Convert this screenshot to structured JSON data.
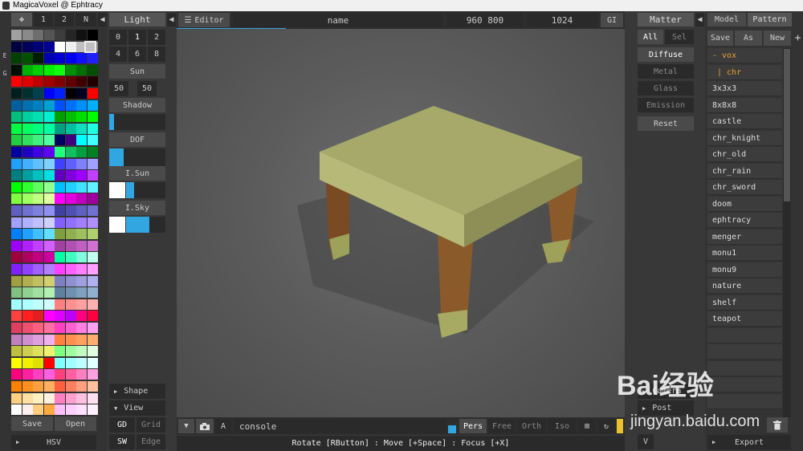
{
  "window": {
    "title": "MagicaVoxel @ Ephtracy"
  },
  "palette_tabs": {
    "labels": [
      "1",
      "2",
      "N"
    ]
  },
  "palette_side_labels": [
    "E",
    "G"
  ],
  "palette_buttons": {
    "save": "Save",
    "open": "Open",
    "hsv": "HSV"
  },
  "light_panel": {
    "title": "Light",
    "num_row1": [
      "0",
      "1",
      "2"
    ],
    "num_row2": [
      "4",
      "6",
      "8"
    ],
    "sun": "Sun",
    "sun_values": [
      "50",
      "50"
    ],
    "shadow": "Shadow",
    "dof": "DOF",
    "isun": "I.Sun",
    "isky": "I.Sky",
    "shape": "Shape",
    "view": "View",
    "gd": "GD",
    "grid": "Grid",
    "sw": "SW",
    "edge": "Edge",
    "shadow_level": 0.08,
    "dof_level": 0.25,
    "isun_level": 0.2,
    "isky_level": 0.6
  },
  "top_bar": {
    "editor": "Editor",
    "name": "name",
    "size": "960 800",
    "samples": "1024",
    "gi": "GI"
  },
  "bottom_bar": {
    "console": "console",
    "a_label": "A",
    "views": [
      "Pers",
      "Free",
      "Orth",
      "Iso"
    ],
    "status": "Rotate [RButton] : Move [+Space] : Focus [+X]"
  },
  "matter_panel": {
    "title": "Matter",
    "all": "All",
    "sel": "Sel",
    "materials": [
      "Diffuse",
      "Metal",
      "Glass",
      "Emission"
    ],
    "reset": "Reset",
    "camera": "Camera",
    "post": "Post",
    "v": "V"
  },
  "model_panel": {
    "tab_model": "Model",
    "tab_pattern": "Pattern",
    "save": "Save",
    "as": "As",
    "new": "New",
    "plus": "+",
    "items": [
      "- vox",
      "| chr",
      "3x3x3",
      "8x8x8",
      "castle",
      "chr_knight",
      "chr_old",
      "chr_rain",
      "chr_sword",
      "doom",
      "ephtracy",
      "menger",
      "monu1",
      "monu9",
      "nature",
      "shelf",
      "teapot"
    ],
    "export": "Export"
  },
  "watermark": {
    "main": "Bai经验",
    "sub": "jingyan.baidu.com"
  },
  "colors": {
    "accent": "#32a6e0",
    "table_top": "#a7a96a",
    "table_leg": "#8b5a2b",
    "leg_foot": "#9da15a",
    "orange_text": "#e8a030"
  }
}
